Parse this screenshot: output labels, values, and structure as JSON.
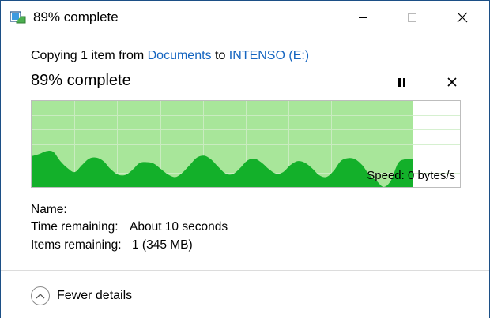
{
  "window": {
    "title": "89% complete",
    "icon": "file-transfer-icon"
  },
  "header": {
    "copy_prefix": "Copying 1 item from",
    "source": "Documents",
    "to_word": "to",
    "destination": "INTENSO (E:)",
    "progress_title": "89% complete"
  },
  "progress": {
    "percent": 89,
    "speed_label": "Speed: 0 bytes/s",
    "speed_history": [
      0.62,
      0.66,
      0.72,
      0.71,
      0.52,
      0.38,
      0.3,
      0.44,
      0.57,
      0.59,
      0.52,
      0.36,
      0.25,
      0.24,
      0.34,
      0.48,
      0.5,
      0.47,
      0.36,
      0.25,
      0.2,
      0.29,
      0.44,
      0.59,
      0.63,
      0.55,
      0.4,
      0.27,
      0.26,
      0.38,
      0.53,
      0.57,
      0.49,
      0.36,
      0.27,
      0.3,
      0.44,
      0.52,
      0.49,
      0.38,
      0.24,
      0.2,
      0.32,
      0.52,
      0.58,
      0.56,
      0.44,
      0.24,
      0.12,
      0.0,
      0.13,
      0.48,
      0.56,
      0.56
    ]
  },
  "details": {
    "name_label": "Name:",
    "name_value": "",
    "time_label": "Time remaining:",
    "time_value": "About 10 seconds",
    "items_label": "Items remaining:",
    "items_value": "1 (345 MB)"
  },
  "footer": {
    "fewer_details": "Fewer details"
  },
  "colors": {
    "fill_light": "#a8e69a",
    "fill_dark": "#13b02a",
    "grid": "#c9ecc0",
    "link": "#1565c0",
    "border": "#1c4f86"
  }
}
